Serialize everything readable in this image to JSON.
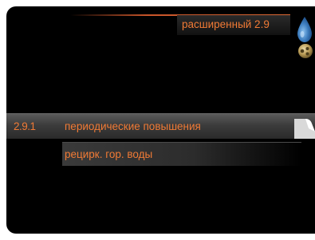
{
  "header": {
    "title": "расширенный 2.9"
  },
  "icons": {
    "top": "water-drop-icon",
    "second": "gear-icon"
  },
  "colors": {
    "accent": "#f07a35",
    "background": "#000000",
    "drop": "#3f7fc0"
  },
  "menu": {
    "items": [
      {
        "number": "2.9.1",
        "label": "периодические повышения",
        "selected": true
      },
      {
        "number": "",
        "label": "рецирк. гор. воды",
        "selected": false
      }
    ]
  }
}
